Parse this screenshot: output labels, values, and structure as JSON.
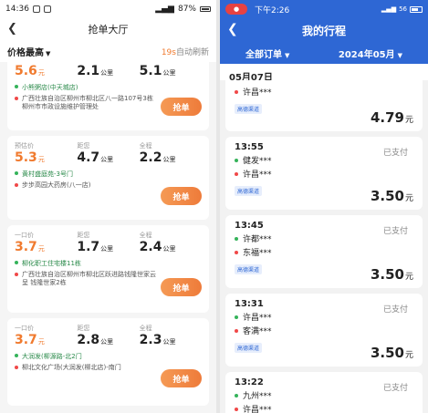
{
  "left": {
    "status": {
      "time": "14:36",
      "battery": "87%"
    },
    "nav": {
      "back": "❮",
      "title": "抢单大厅"
    },
    "filter": {
      "sort": "价格最高",
      "refresh_count": "19s",
      "refresh_text": "自动刷新"
    },
    "labels": {
      "price": "预估价",
      "fixed": "一口价",
      "distance": "距您",
      "trip": "全程",
      "km": "公里",
      "yuan": "元",
      "grab": "抢单"
    },
    "cards": [
      {
        "price_label": "",
        "distance_label": "",
        "trip_label": "",
        "price": "5.6",
        "distance": "2.1",
        "trip": "5.1",
        "from": "小熊粥店(中天城店)",
        "to": "广西壮族自治区柳州市柳北区八一路107号3栋柳州市市政设施维护管理处"
      },
      {
        "price_label": "预估价",
        "distance_label": "距您",
        "trip_label": "全程",
        "price": "5.3",
        "distance": "4.7",
        "trip": "2.2",
        "from": "黄村盛庭苑-3号门",
        "to": "步步高园大药房(八一店)"
      },
      {
        "price_label": "一口价",
        "distance_label": "距您",
        "trip_label": "全程",
        "price": "3.7",
        "distance": "1.7",
        "trip": "2.4",
        "from": "柳化职工住宅楼11栋",
        "to": "广西壮族自治区柳州市柳北区跃进路钱隆世家云呈 钱隆世家2栋"
      },
      {
        "price_label": "一口价",
        "distance_label": "距您",
        "trip_label": "全程",
        "price": "3.7",
        "distance": "2.8",
        "trip": "2.3",
        "from": "大润发(柳源路-北2门",
        "to": "柳北文化广场(大润发(柳北店)-南门"
      }
    ]
  },
  "right": {
    "status": {
      "rec": "●",
      "time": "下午2:26",
      "battery": "56"
    },
    "nav": {
      "back": "❮",
      "title": "我的行程"
    },
    "tabs": {
      "orders": "全部订单",
      "month": "2024年05月"
    },
    "date": "05月07日",
    "labels": {
      "paid": "已支付",
      "tag": "高德渠道",
      "yuan": "元"
    },
    "trips": [
      {
        "time": "",
        "status": "",
        "from": "",
        "to": "许昌***",
        "price": "4.79"
      },
      {
        "time": "13:55",
        "status": "已支付",
        "from": "健发***",
        "to": "许昌***",
        "price": "3.50"
      },
      {
        "time": "13:45",
        "status": "已支付",
        "from": "许都***",
        "to": "东福***",
        "price": "3.50"
      },
      {
        "time": "13:31",
        "status": "已支付",
        "from": "许昌***",
        "to": "客满***",
        "price": "3.50"
      },
      {
        "time": "13:22",
        "status": "已支付",
        "from": "九州***",
        "to": "许昌***",
        "price": ""
      }
    ]
  }
}
